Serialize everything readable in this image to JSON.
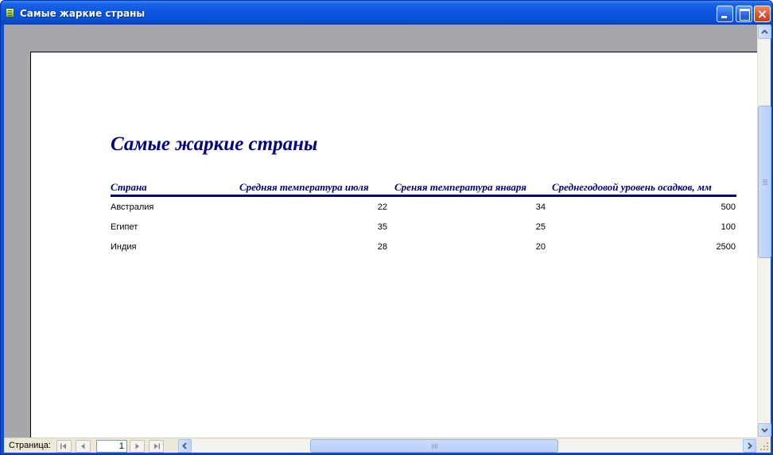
{
  "window": {
    "title": "Самые жаркие страны",
    "close_glyph": "×",
    "accent": "#0a4fd6"
  },
  "report": {
    "title": "Самые жаркие страны",
    "title_color": "#000080",
    "columns": [
      "Страна",
      "Средняя температура июля",
      "Среняя температура января",
      "Среднегодовой уровень осадков, мм"
    ],
    "rows": [
      {
        "country": "Австралия",
        "july": "22",
        "january": "34",
        "rainfall": "500"
      },
      {
        "country": "Египет",
        "july": "35",
        "january": "25",
        "rainfall": "100"
      },
      {
        "country": "Индия",
        "july": "28",
        "january": "20",
        "rainfall": "2500"
      }
    ]
  },
  "navigation": {
    "page_label": "Страница:",
    "current_page": "1",
    "first_icon": "first-page-icon",
    "prev_icon": "previous-page-icon",
    "next_icon": "next-page-icon",
    "last_icon": "last-page-icon"
  }
}
